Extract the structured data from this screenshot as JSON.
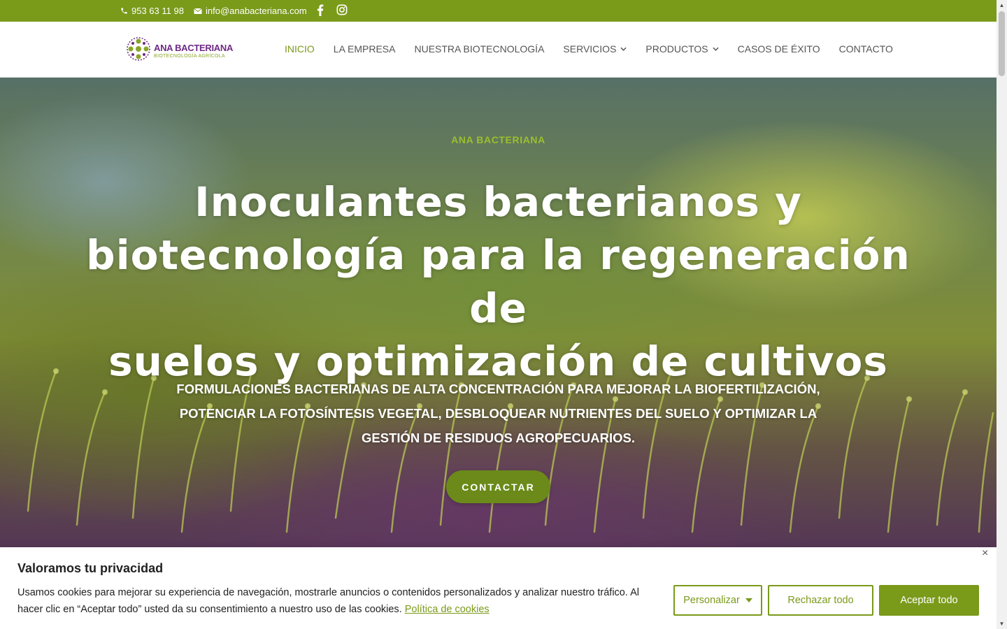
{
  "topbar": {
    "phone": "953 63 11 98",
    "email": "info@anabacteriana.com",
    "icons": [
      "phone-icon",
      "mail-icon",
      "facebook-icon",
      "instagram-icon"
    ]
  },
  "header": {
    "logo_name": "ANA BACTERIANA",
    "logo_sub": "BIOTECNOLOGÍA AGRÍCOLA",
    "nav": [
      {
        "label": "INICIO",
        "active": true
      },
      {
        "label": "LA EMPRESA"
      },
      {
        "label": "NUESTRA BIOTECNOLOGÍA"
      },
      {
        "label": "SERVICIOS",
        "dropdown": true
      },
      {
        "label": "PRODUCTOS",
        "dropdown": true
      },
      {
        "label": "CASOS DE ÉXITO"
      },
      {
        "label": "CONTACTO"
      }
    ]
  },
  "hero": {
    "eyebrow": "ANA BACTERIANA",
    "headline_l1": "Inoculantes bacterianos y",
    "headline_l2": "biotecnología para la regeneración de",
    "headline_l3": "suelos y optimización de cultivos",
    "sub_l1": "FORMULACIONES BACTERIANAS DE ALTA CONCENTRACIÓN PARA MEJORAR LA BIOFERTILIZACIÓN,",
    "sub_l2": "POTENCIAR LA FOTOSÍNTESIS VEGETAL, DESBLOQUEAR NUTRIENTES DEL SUELO Y OPTIMIZAR LA",
    "sub_l3": "GESTIÓN DE RESIDUOS AGROPECUARIOS.",
    "cta": "CONTACTAR"
  },
  "cookie": {
    "title": "Valoramos tu privacidad",
    "text": "Usamos cookies para mejorar su experiencia de navegación, mostrarle anuncios o contenidos personalizados y analizar nuestro tráfico. Al hacer clic en “Aceptar todo” usted da su consentimiento a nuestro uso de las cookies.",
    "link": "Política de cookies",
    "customize": "Personalizar",
    "reject": "Rechazar todo",
    "accept": "Aceptar todo",
    "close": "×"
  },
  "colors": {
    "brand_green": "#7a9a1a",
    "brand_purple": "#6e2a85",
    "eyebrow_green": "#9cbf2e"
  }
}
